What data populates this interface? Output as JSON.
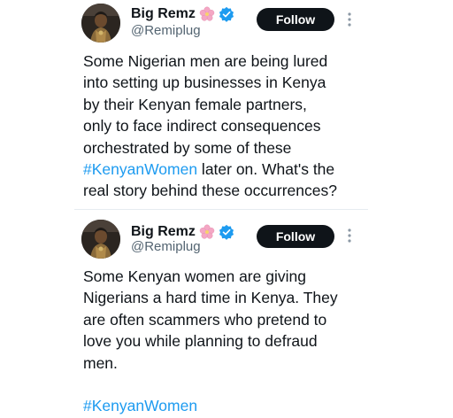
{
  "colors": {
    "text_primary": "#0f1419",
    "text_secondary": "#536471",
    "hashtag": "#1d9bf0",
    "follow_button_bg": "#0f1419",
    "verified": "#1d9bf0",
    "flower": "#f4a7c4"
  },
  "tweets": [
    {
      "author": {
        "display_name": "Big Remz",
        "handle": "@Remiplug",
        "name_emoji_icon": "cherry-blossom-icon",
        "verified_icon": "verified-badge-icon"
      },
      "follow_label": "Follow",
      "more_icon": "more-vertical-icon",
      "text_before_hashtag": "Some Nigerian men are being lured\ninto setting up businesses in Kenya\nby their Kenyan female partners,\nonly to face indirect consequences\norchestrated by some of these\n",
      "hashtag": "#KenyanWomen",
      "text_after_hashtag": " later on. What's the\nreal story behind these occurrences?"
    },
    {
      "author": {
        "display_name": "Big Remz",
        "handle": "@Remiplug",
        "name_emoji_icon": "cherry-blossom-icon",
        "verified_icon": "verified-badge-icon"
      },
      "follow_label": "Follow",
      "more_icon": "more-vertical-icon",
      "text_before_hashtag": "Some Kenyan women are giving\nNigerians a hard time in Kenya. They\nare often scammers who pretend to\nlove you while planning to defraud\nmen.\n\n",
      "hashtag": "#KenyanWomen",
      "text_after_hashtag": ""
    }
  ]
}
